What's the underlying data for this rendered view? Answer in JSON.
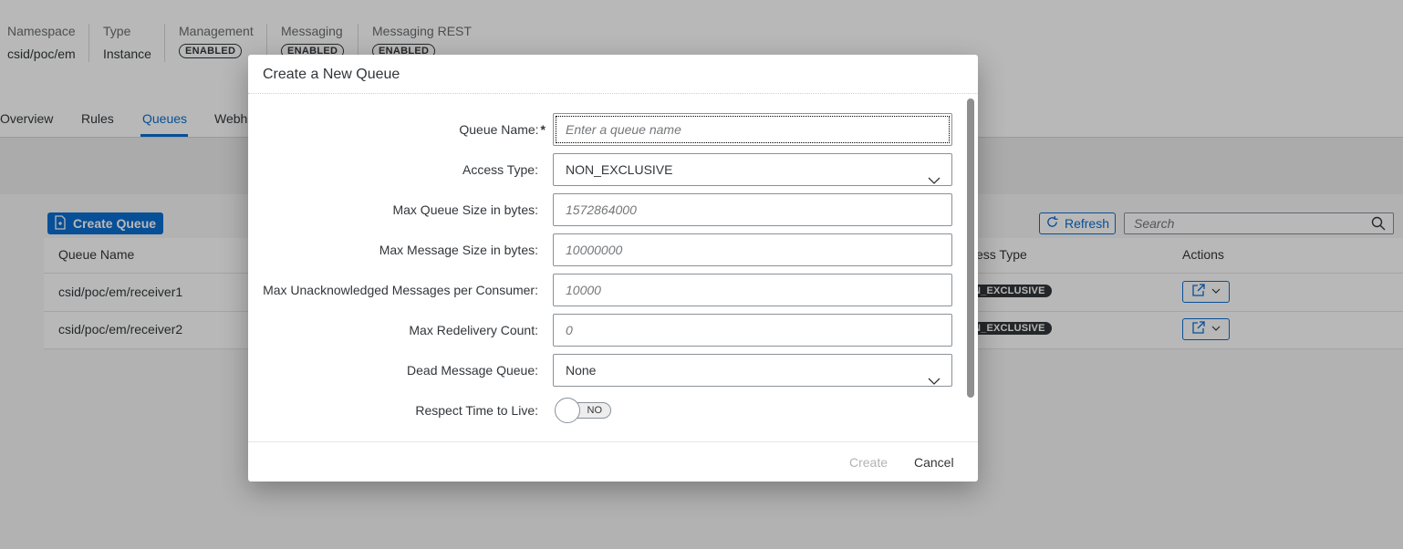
{
  "header": {
    "namespace_label": "Namespace",
    "namespace_value": "csid/poc/em",
    "type_label": "Type",
    "type_value": "Instance",
    "management_label": "Management",
    "management_value": "ENABLED",
    "messaging_label": "Messaging",
    "messaging_value": "ENABLED",
    "messaging_rest_label": "Messaging REST",
    "messaging_rest_value": "ENABLED"
  },
  "tabs": [
    {
      "label": "Overview"
    },
    {
      "label": "Rules"
    },
    {
      "label": "Queues",
      "active": true
    },
    {
      "label": "Webh"
    }
  ],
  "toolbar": {
    "create_queue_label": "Create Queue",
    "refresh_label": "Refresh",
    "search_placeholder": "Search"
  },
  "table": {
    "columns": [
      "Queue Name",
      "ess Type",
      "Actions"
    ],
    "rows": [
      {
        "name": "csid/poc/em/receiver1",
        "access_type": "N_EXCLUSIVE"
      },
      {
        "name": "csid/poc/em/receiver2",
        "access_type": "N_EXCLUSIVE"
      }
    ]
  },
  "dialog": {
    "title": "Create a New Queue",
    "fields": {
      "queue_name": {
        "label": "Queue Name:",
        "required_marker": "*",
        "placeholder": "Enter a queue name"
      },
      "access_type": {
        "label": "Access Type:",
        "value": "NON_EXCLUSIVE"
      },
      "max_queue_size": {
        "label": "Max Queue Size in bytes:",
        "placeholder": "1572864000"
      },
      "max_message_size": {
        "label": "Max Message Size in bytes:",
        "placeholder": "10000000"
      },
      "max_unacked": {
        "label": "Max Unacknowledged Messages per Consumer:",
        "placeholder": "10000"
      },
      "max_redelivery": {
        "label": "Max Redelivery Count:",
        "placeholder": "0"
      },
      "dead_message_queue": {
        "label": "Dead Message Queue:",
        "value": "None"
      },
      "respect_ttl": {
        "label": "Respect Time to Live:",
        "value": "NO"
      }
    },
    "create_label": "Create",
    "cancel_label": "Cancel"
  },
  "colors": {
    "accent": "#0a6ed1",
    "text": "#32363a",
    "disabled": "#b3b3b3"
  },
  "icons": {
    "create_queue": "document-add-icon",
    "refresh": "refresh-icon",
    "search": "search-icon",
    "action": "share-icon",
    "dropdown": "chevron-down-icon"
  }
}
